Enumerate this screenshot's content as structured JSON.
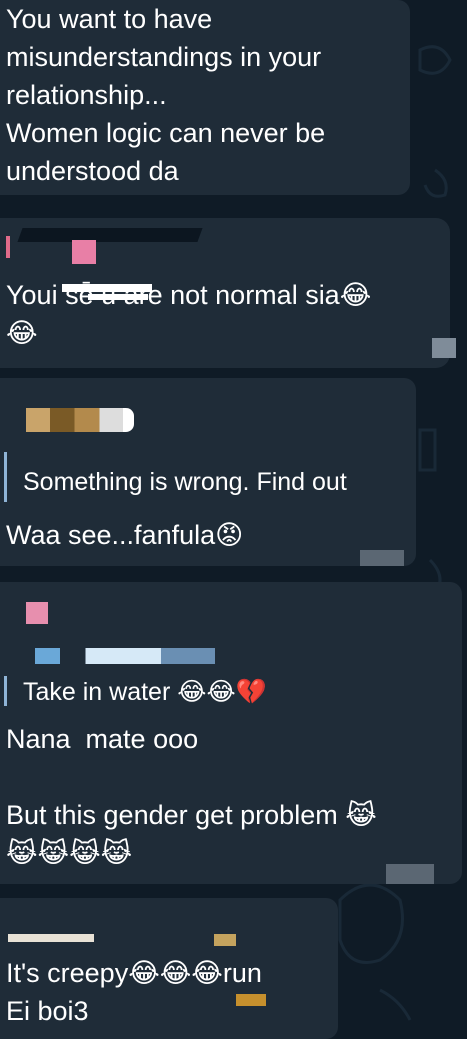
{
  "messages": [
    {
      "text": "You want to have\nmisunderstandings in your\nrelationship...\nWomen logic can never be\nunderstood da"
    },
    {
      "text": "Youi sē̄ u are not normal sia😂\n😂"
    },
    {
      "reply": "Something is wrong. Find out",
      "text": "Waa see...fanfula😡"
    },
    {
      "reply": "Take in water 😂😂💔",
      "text": "Nana  mate ooo\n\nBut this gender get problem 😹\n😹😹😹😹"
    },
    {
      "text": "It's creepy😂😂😂run\nEi boi3"
    }
  ],
  "colors": {
    "background": "#0f1b26",
    "bubble": "#1f2c38",
    "reply_bar": "#8fb4d6"
  },
  "icons": [
    "laughing-crying-emoji",
    "angry-face-emoji",
    "broken-heart-emoji",
    "cat-tears-emoji"
  ]
}
